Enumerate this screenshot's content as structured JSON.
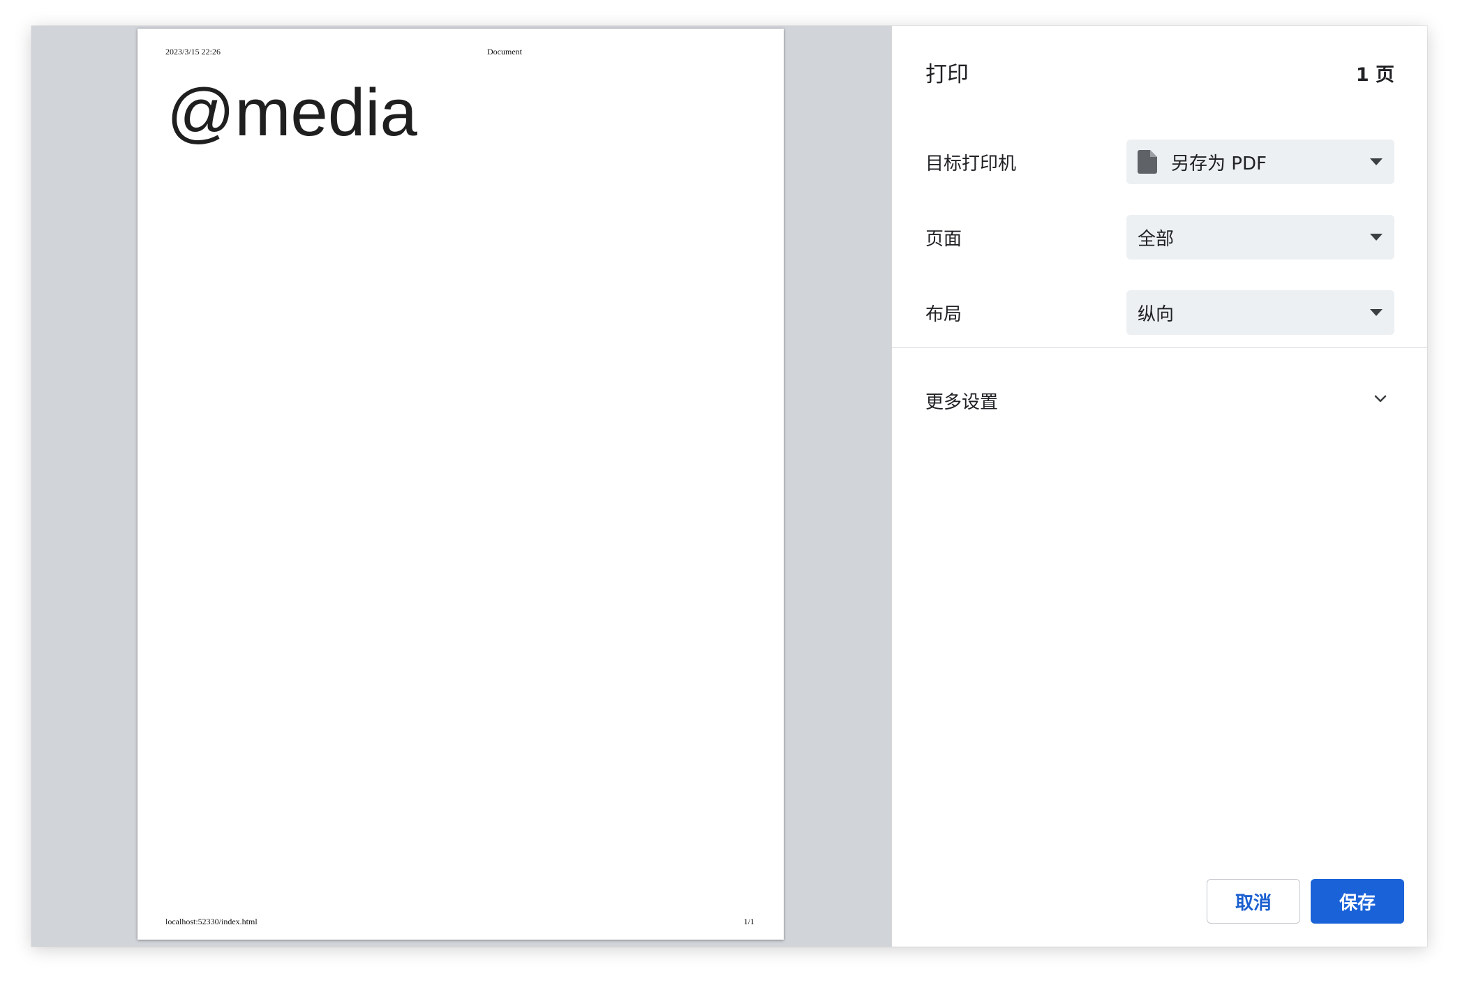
{
  "preview": {
    "header_date": "2023/3/15 22:26",
    "header_title": "Document",
    "heading": "@media",
    "footer_url": "localhost:52330/index.html",
    "footer_page": "1/1"
  },
  "panel": {
    "title": "打印",
    "page_count": "1 页",
    "destination": {
      "label": "目标打印机",
      "value": "另存为 PDF",
      "icon": "file-icon"
    },
    "pages": {
      "label": "页面",
      "value": "全部"
    },
    "layout": {
      "label": "布局",
      "value": "纵向"
    },
    "more_settings": "更多设置",
    "cancel_label": "取消",
    "save_label": "保存"
  },
  "colors": {
    "preview_background": "#d1d4d9",
    "select_background": "#edf0f2",
    "primary_button": "#1a62d8",
    "link_text": "#1a5fd0"
  }
}
